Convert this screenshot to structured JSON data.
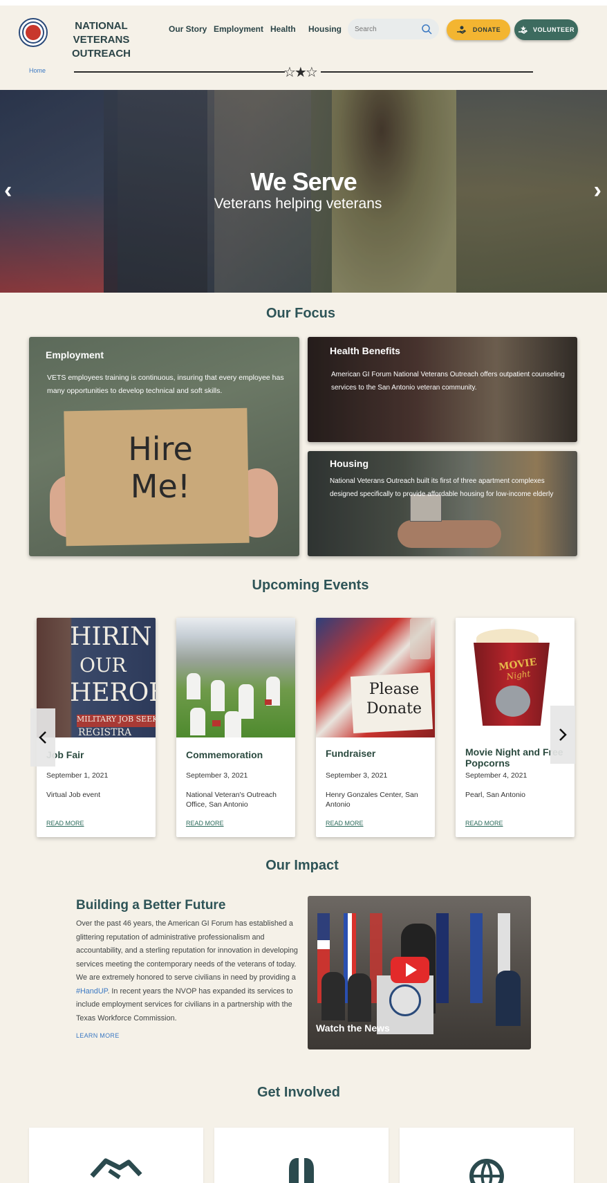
{
  "header": {
    "org_name": "NATIONAL VETERANS OUTREACH",
    "nav": [
      "Our Story",
      "Employment",
      "Health",
      "Housing"
    ],
    "search_placeholder": "Search",
    "donate_label": "DONATE",
    "volunteer_label": "VOLUNTEER"
  },
  "breadcrumb": {
    "home": "Home"
  },
  "hero": {
    "title": "We Serve",
    "subtitle": "Veterans helping veterans"
  },
  "focus": {
    "section_title": "Our Focus",
    "cards": [
      {
        "title": "Employment",
        "text": "VETS employees training is continuous, insuring that every employee has many opportunities to develop technical and soft skills.",
        "sign_text": "Hire Me!"
      },
      {
        "title": "Health Benefits",
        "text": "American GI Forum National Veterans Outreach offers outpatient counseling services to the San Antonio veteran community."
      },
      {
        "title": "Housing",
        "text": "National Veterans Outreach built its first of three apartment complexes designed specifically to provide affordable housing for low-income elderly"
      }
    ]
  },
  "events": {
    "section_title": "Upcoming Events",
    "read_more": "READ MORE",
    "items": [
      {
        "title": "Job Fair",
        "date": "September 1, 2021",
        "location": "Virtual Job event",
        "img_text": [
          "HIRIN",
          "OUR",
          "HEROE",
          "MILITARY JOB SEEK",
          "REGISTRA"
        ]
      },
      {
        "title": "Commemoration",
        "date": "September 3, 2021",
        "location": "National Veteran's Outreach Office, San Antonio"
      },
      {
        "title": "Fundraiser",
        "date": "September 3, 2021",
        "location": "Henry Gonzales Center, San Antonio",
        "img_text": [
          "Please",
          "Donate"
        ]
      },
      {
        "title": "Movie Night and Free Popcorns",
        "date": "September 4, 2021",
        "location": "Pearl, San Antonio",
        "img_text": [
          "MOVIE",
          "Night"
        ]
      }
    ]
  },
  "impact": {
    "section_title": "Our Impact",
    "heading": "Building a Better Future",
    "text_before": "Over the past 46 years, the American GI Forum has established a glittering reputation of administrative professionalism and accountability, and a sterling reputation for innovation in developing services meeting the contemporary needs of the veterans of today. We are extremely honored to serve civilians in need by providing a ",
    "hashtag": "#HandUP",
    "text_after": ". In recent years the NVOP has expanded its services to include employment services for civilians in a partnership with the Texas Workforce Commission.",
    "learn_more": "LEARN MORE",
    "video_caption": "Watch the News"
  },
  "involved": {
    "section_title": "Get Involved"
  },
  "colors": {
    "background": "#f5f1e8",
    "heading": "#2e5457",
    "donate": "#f3b531",
    "volunteer": "#3d6b5f",
    "link": "#3a78c2"
  }
}
